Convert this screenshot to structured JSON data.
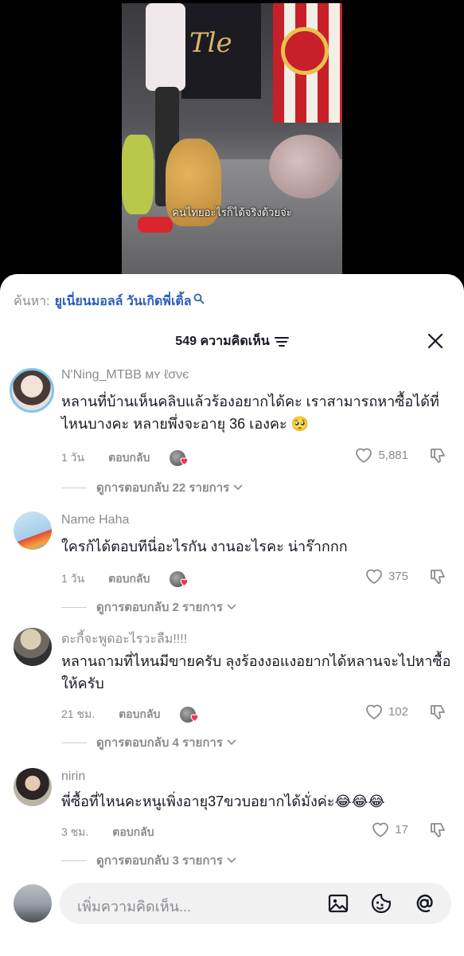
{
  "video": {
    "caption": "คนไทยอะไรก็ได้จริงด้วยจ่ะ",
    "poster_text": "Tle"
  },
  "search": {
    "prefix": "ค้นหา:",
    "term": "ยูเนี่ยนมอลล์ วันเกิดพี่เติ้ล"
  },
  "header": {
    "comment_count": "549 ความคิดเห็น"
  },
  "comments": [
    {
      "name": "N'Ning_MTBB ᴍʏ ℓσνє",
      "text": "หลานที่บ้านเห็นคลิบแล้วร้องอยากได้คะ เราสามารถหาซื้อได้ที่ไหนบางคะ หลายพึ่งจะอายุ 36 เองคะ 🥺",
      "time": "1 วัน",
      "reply_label": "ตอบกลับ",
      "likes": "5,881",
      "replies": "ดูการตอบกลับ 22 รายการ"
    },
    {
      "name": "Name Haha",
      "text": "ใครก้ได้ตอบทีนี่อะไรกัน งานอะไรคะ น่าร๊ากกก",
      "time": "1 วัน",
      "reply_label": "ตอบกลับ",
      "likes": "375",
      "replies": "ดูการตอบกลับ 2 รายการ"
    },
    {
      "name": "ตะกี้จะพูดอะไรวะลืม!!!!",
      "text": "หลานถามที่ไหนมีขายครับ ลุงร้องงอแงอยากได้หลานจะไปหาซื้อให้ครับ",
      "time": "21 ชม.",
      "reply_label": "ตอบกลับ",
      "likes": "102",
      "replies": "ดูการตอบกลับ 4 รายการ"
    },
    {
      "name": "nirin",
      "text": "พี่ซื้อที่ไหนคะหนูเพิ่งอายุ37ขวบอยากได้มั่งค่ะ😂😂😂",
      "time": "3 ชม.",
      "reply_label": "ตอบกลับ",
      "likes": "17",
      "replies": "ดูการตอบกลับ 3 รายการ"
    }
  ],
  "composer": {
    "placeholder": "เพิ่มความคิดเห็น..."
  },
  "colors": {
    "accent_link": "#2b5db8",
    "secondary_text": "#8a8b91",
    "heart_red": "#fe2c55"
  },
  "icons": [
    "search-icon",
    "filter-icon",
    "close-icon",
    "heart-icon",
    "dislike-icon",
    "chevron-down-icon",
    "image-icon",
    "emoji-icon",
    "mention-icon"
  ]
}
